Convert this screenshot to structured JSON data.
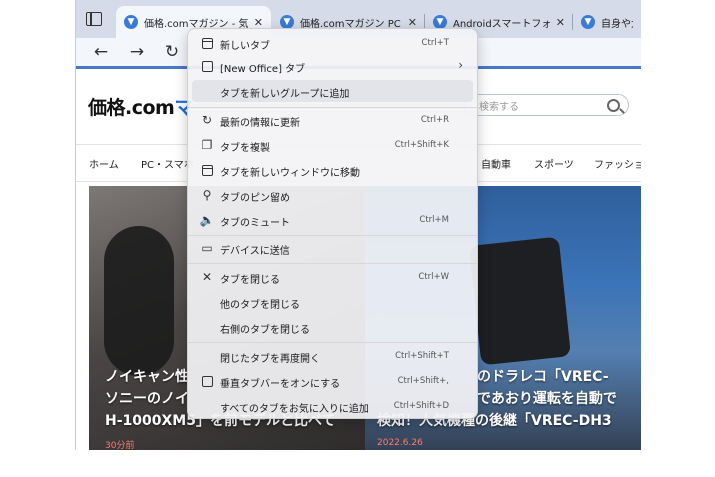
{
  "tabs": [
    {
      "title": "価格.comマガジン - 気になる",
      "active": true
    },
    {
      "title": "価格.comマガジン PC・スマ"
    },
    {
      "title": "Androidスマートフォンとi"
    },
    {
      "title": "自身や大切"
    }
  ],
  "page": {
    "logo_main": "価格.com",
    "logo_rest": "マ",
    "search_placeholder": "検索する",
    "nav": [
      "ホーム",
      "PC・スマホ",
      "自動車",
      "スポーツ",
      "ファッショ"
    ]
  },
  "cards": [
    {
      "lines": [
        "ノイキャン性",
        "ソニーのノイ",
        "H-1000XM5」を前モデルと比べて"
      ],
      "time": "30分前"
    },
    {
      "lines": [
        "のドラレコ「VREC-",
        "であおり運転を自動で",
        "検知！人気機種の後継「VREC-DH3"
      ],
      "time": "2022.6.26"
    }
  ],
  "menu": {
    "items": [
      {
        "label": "新しいタブ",
        "shortcut": "Ctrl+T",
        "icon": "new-tab-icon"
      },
      {
        "label": "[New Office] タブ",
        "arrow": "›",
        "icon": "office-icon"
      },
      {
        "label": "タブを新しいグループに追加",
        "hover": true
      },
      {
        "label": "最新の情報に更新",
        "shortcut": "Ctrl+R",
        "icon": "refresh-icon"
      },
      {
        "label": "タブを複製",
        "shortcut": "Ctrl+Shift+K",
        "icon": "duplicate-icon"
      },
      {
        "label": "タブを新しいウィンドウに移動",
        "icon": "new-window-icon"
      },
      {
        "label": "タブのピン留め",
        "icon": "pin-icon"
      },
      {
        "label": "タブのミュート",
        "shortcut": "Ctrl+M",
        "icon": "mute-icon"
      },
      {
        "label": "デバイスに送信",
        "icon": "devices-icon"
      },
      {
        "label": "タブを閉じる",
        "shortcut": "Ctrl+W",
        "icon": "close-icon"
      },
      {
        "label": "他のタブを閉じる"
      },
      {
        "label": "右側のタブを閉じる"
      },
      {
        "label": "閉じたタブを再度開く",
        "shortcut": "Ctrl+Shift+T"
      },
      {
        "label": "垂直タブバーをオンにする",
        "shortcut": "Ctrl+Shift+,",
        "icon": "vertical-tabs-icon"
      },
      {
        "label": "すべてのタブをお気に入りに追加",
        "shortcut": "Ctrl+Shift+D"
      }
    ]
  }
}
